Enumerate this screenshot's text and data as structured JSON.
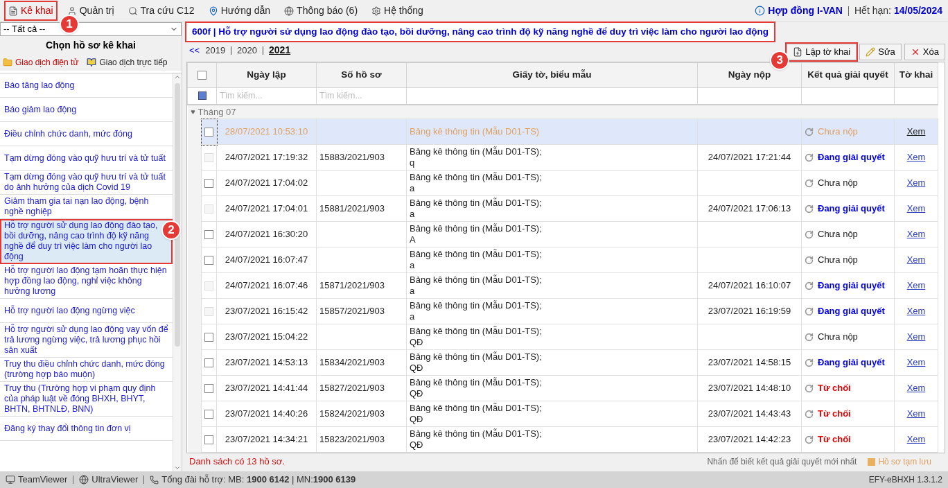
{
  "menu": [
    {
      "label": "Kê khai",
      "selected": true,
      "callout": "1"
    },
    {
      "label": "Quản trị",
      "selected": false
    },
    {
      "label": "Tra cứu C12",
      "selected": false
    },
    {
      "label": "Hướng dẫn",
      "selected": false
    },
    {
      "label": "Thông báo (6)",
      "selected": false
    },
    {
      "label": "Hệ thống",
      "selected": false
    }
  ],
  "contract": {
    "label": "Hợp đồng I-VAN",
    "expiry_label": "Hết hạn:",
    "expiry": "14/05/2024"
  },
  "sidebar": {
    "filter": "-- Tất cả --",
    "title": "Chọn hồ sơ kê khai",
    "tabs": [
      {
        "label": "Giao dịch điện tử",
        "selected": true
      },
      {
        "label": "Giao dịch trực tiếp",
        "selected": false
      }
    ],
    "items": [
      {
        "label": "Báo tăng lao động",
        "selected": false
      },
      {
        "label": "Báo giảm lao động",
        "selected": false
      },
      {
        "label": "Điều chỉnh chức danh, mức đóng",
        "selected": false
      },
      {
        "label": "Tạm dừng đóng vào quỹ hưu trí và tử tuất",
        "selected": false
      },
      {
        "label": "Tạm dừng đóng vào quỹ hưu trí và tử tuất do ảnh hưởng của dịch Covid 19",
        "selected": false
      },
      {
        "label": "Giảm tham gia tai nạn lao động, bệnh nghề nghiệp",
        "selected": false
      },
      {
        "label": "Hỗ trợ người sử dụng lao động đào tạo, bồi dưỡng, nâng cao trình độ kỹ năng nghề để duy trì việc làm cho người lao động",
        "selected": true,
        "callout": "2"
      },
      {
        "label": "Hỗ trợ người lao động tạm hoãn thực hiện hợp đồng lao động, nghỉ việc không hưởng lương",
        "selected": false
      },
      {
        "label": "Hỗ trợ người lao động ngừng việc",
        "selected": false
      },
      {
        "label": "Hỗ trợ người sử dụng lao động vay vốn để trả lương ngừng việc, trả lương phục hồi sản xuất",
        "selected": false
      },
      {
        "label": "Truy thu điều chỉnh chức danh, mức đóng (trường hợp báo muộn)",
        "selected": false
      },
      {
        "label": "Truy thu (Trường hợp vi phạm quy định của pháp luật về đóng BHXH, BHYT, BHTN, BHTNLĐ, BNN)",
        "selected": false
      },
      {
        "label": "Đăng ký thay đổi thông tin đơn vị",
        "selected": false
      }
    ]
  },
  "form_title": {
    "text": "600f | Hỗ trợ người sử dụng lao động đào tạo, bồi dưỡng, nâng cao trình độ kỹ năng nghề để duy trì việc làm cho người lao động"
  },
  "years": {
    "back": "<<",
    "items": [
      {
        "label": "2019",
        "selected": false
      },
      {
        "label": "2020",
        "selected": false
      },
      {
        "label": "2021",
        "selected": true
      }
    ]
  },
  "actions": [
    {
      "label": "Lập tờ khai",
      "kind": "new",
      "callout": "3"
    },
    {
      "label": "Sửa",
      "kind": "edit"
    },
    {
      "label": "Xóa",
      "kind": "delete"
    }
  ],
  "table": {
    "columns": [
      "Ngày lập",
      "Số hồ sơ",
      "Giấy tờ, biểu mẫu",
      "Ngày nộp",
      "Kết quả giải quyết",
      "Tờ khai"
    ],
    "select_all": {
      "checked": false
    },
    "search_placeholders": [
      "Tìm kiếm...",
      "Tìm kiếm..."
    ],
    "group": "Tháng 07",
    "rows": [
      {
        "created": "28/07/2021 10:53:10",
        "document": "Bảng kê thông tin (Mẫu D01-TS)",
        "result": "Chưa nộp",
        "kind": "pending",
        "view": "Xem",
        "selected": true,
        "draft": true,
        "disabled": false
      },
      {
        "created": "24/07/2021 17:19:32",
        "number": "15883/2021/903",
        "document": "Bảng kê thông tin (Mẫu D01-TS);",
        "note": "q",
        "submitted": "24/07/2021 17:21:44",
        "result": "Đang giải quyết",
        "kind": "processing",
        "view": "Xem",
        "selected": false,
        "draft": false,
        "disabled": true
      },
      {
        "created": "24/07/2021 17:04:02",
        "document": "Bảng kê thông tin (Mẫu D01-TS);",
        "note": "a",
        "result": "Chưa nộp",
        "kind": "pending",
        "view": "Xem",
        "selected": false,
        "draft": false,
        "disabled": false
      },
      {
        "created": "24/07/2021 17:04:01",
        "number": "15881/2021/903",
        "document": "Bảng kê thông tin (Mẫu D01-TS);",
        "note": "a",
        "submitted": "24/07/2021 17:06:13",
        "result": "Đang giải quyết",
        "kind": "processing",
        "view": "Xem",
        "selected": false,
        "draft": false,
        "disabled": true
      },
      {
        "created": "24/07/2021 16:30:20",
        "document": "Bảng kê thông tin (Mẫu D01-TS);",
        "note": "A",
        "result": "Chưa nộp",
        "kind": "pending",
        "view": "Xem",
        "selected": false,
        "draft": false,
        "disabled": false
      },
      {
        "created": "24/07/2021 16:07:47",
        "document": "Bảng kê thông tin (Mẫu D01-TS);",
        "note": "a",
        "result": "Chưa nộp",
        "kind": "pending",
        "view": "Xem",
        "selected": false,
        "draft": false,
        "disabled": false
      },
      {
        "created": "24/07/2021 16:07:46",
        "number": "15871/2021/903",
        "document": "Bảng kê thông tin (Mẫu D01-TS);",
        "note": "a",
        "submitted": "24/07/2021 16:10:07",
        "result": "Đang giải quyết",
        "kind": "processing",
        "view": "Xem",
        "selected": false,
        "draft": false,
        "disabled": true
      },
      {
        "created": "23/07/2021 16:15:42",
        "number": "15857/2021/903",
        "document": "Bảng kê thông tin (Mẫu D01-TS);",
        "note": "a",
        "submitted": "23/07/2021 16:19:59",
        "result": "Đang giải quyết",
        "kind": "processing",
        "view": "Xem",
        "selected": false,
        "draft": false,
        "disabled": true
      },
      {
        "created": "23/07/2021 15:04:22",
        "document": "Bảng kê thông tin (Mẫu D01-TS);",
        "note": "QĐ",
        "result": "Chưa nộp",
        "kind": "pending",
        "view": "Xem",
        "selected": false,
        "draft": false,
        "disabled": false
      },
      {
        "created": "23/07/2021 14:53:13",
        "number": "15834/2021/903",
        "document": "Bảng kê thông tin (Mẫu D01-TS);",
        "note": "QĐ",
        "submitted": "23/07/2021 14:58:15",
        "result": "Đang giải quyết",
        "kind": "processing",
        "view": "Xem",
        "selected": false,
        "draft": false,
        "disabled": false
      },
      {
        "created": "23/07/2021 14:41:44",
        "number": "15827/2021/903",
        "document": "Bảng kê thông tin (Mẫu D01-TS);",
        "note": "QĐ",
        "submitted": "23/07/2021 14:48:10",
        "result": "Từ chối",
        "kind": "rejected",
        "view": "Xem",
        "selected": false,
        "draft": false,
        "disabled": false
      },
      {
        "created": "23/07/2021 14:40:26",
        "number": "15824/2021/903",
        "document": "Bảng kê thông tin (Mẫu D01-TS);",
        "note": "QĐ",
        "submitted": "23/07/2021 14:43:43",
        "result": "Từ chối",
        "kind": "rejected",
        "view": "Xem",
        "selected": false,
        "draft": false,
        "disabled": false
      },
      {
        "created": "23/07/2021 14:34:21",
        "number": "15823/2021/903",
        "document": "Bảng kê thông tin (Mẫu D01-TS);",
        "note": "QĐ",
        "submitted": "23/07/2021 14:42:23",
        "result": "Từ chối",
        "kind": "rejected",
        "view": "Xem",
        "selected": false,
        "draft": false,
        "disabled": false
      }
    ]
  },
  "footer": {
    "count": "Danh sách có 13 hồ sơ.",
    "hint": "Nhấn để biết kết quả giải quyết mới nhất",
    "legend": "Hồ sơ tạm lưu"
  },
  "status_bar": {
    "items": [
      "TeamViewer",
      "UltraViewer"
    ],
    "hotline": "Tổng đài hỗ trợ: MB: **1900 6142** | MN:**1900 6139**",
    "version": "EFY-eBHXH 1.3.1.2"
  }
}
